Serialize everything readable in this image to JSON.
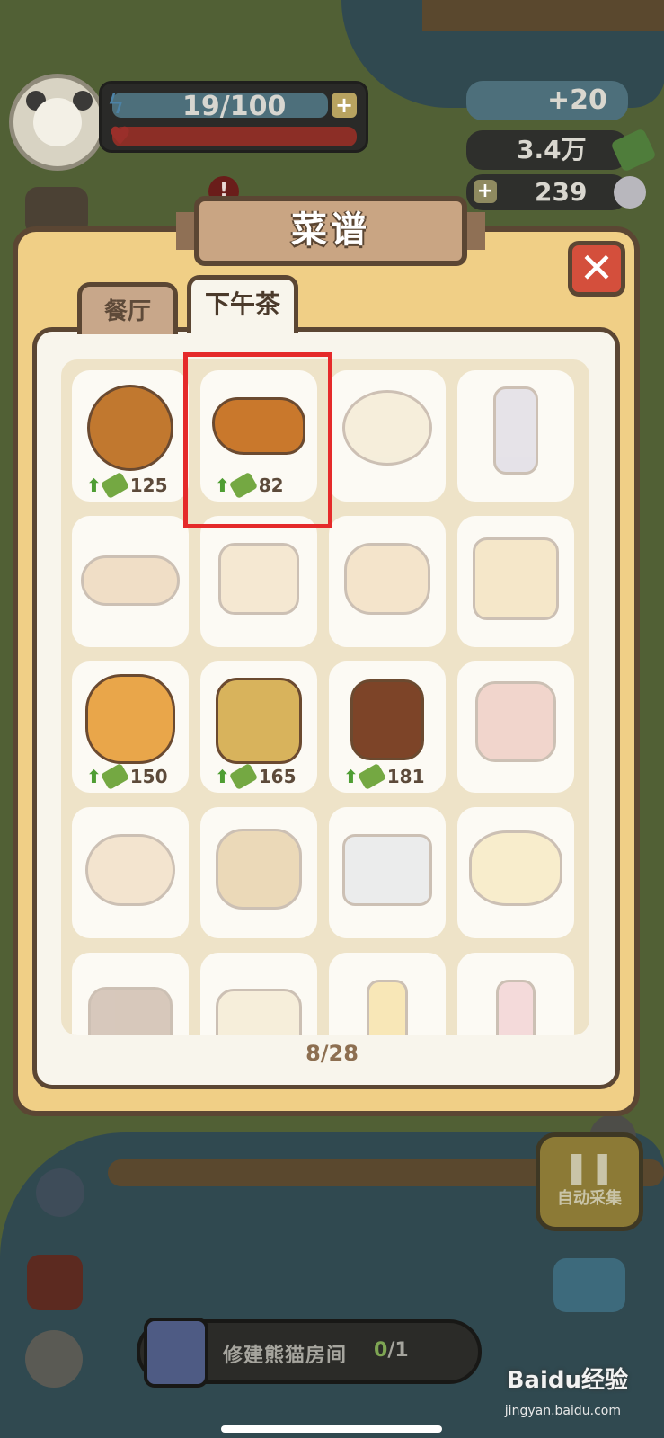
{
  "hud": {
    "energy": "19/100",
    "energy_plus": "+",
    "bamboo_rate": "+20",
    "bamboo_total": "3.4万",
    "pearl_plus": "+",
    "pearls": "239",
    "alert": "!"
  },
  "modal": {
    "title": "菜谱",
    "close": "✕",
    "tabs": [
      {
        "label": "餐厅",
        "active": false
      },
      {
        "label": "下午茶",
        "active": true
      }
    ],
    "page": "8/28"
  },
  "recipes": [
    {
      "name": "donut-icon",
      "price": "125",
      "unlocked": true
    },
    {
      "name": "croissant-icon",
      "price": "82",
      "unlocked": true,
      "highlighted": true
    },
    {
      "name": "dumpling-bun-icon",
      "unlocked": false
    },
    {
      "name": "flower-jar-icon",
      "unlocked": false
    },
    {
      "name": "baguette-trio-icon",
      "unlocked": false
    },
    {
      "name": "pancake-stack-icon",
      "unlocked": false
    },
    {
      "name": "blueberry-pudding-icon",
      "unlocked": false
    },
    {
      "name": "wrapped-cake-icon",
      "unlocked": false
    },
    {
      "name": "cookie-bag-icon",
      "price": "150",
      "unlocked": true
    },
    {
      "name": "mango-cake-icon",
      "price": "165",
      "unlocked": true
    },
    {
      "name": "cherry-chocolate-cake-icon",
      "price": "181",
      "unlocked": true
    },
    {
      "name": "cream-cake-icon",
      "unlocked": false
    },
    {
      "name": "strawberry-roll-icon",
      "unlocked": false
    },
    {
      "name": "fruit-tart-icon",
      "unlocked": false
    },
    {
      "name": "blueberry-cup-icon",
      "unlocked": false
    },
    {
      "name": "lemon-cake-icon",
      "unlocked": false
    },
    {
      "name": "chocolate-cake-icon",
      "unlocked": false
    },
    {
      "name": "berry-tart-icon",
      "unlocked": false
    },
    {
      "name": "orange-juice-icon",
      "unlocked": false
    },
    {
      "name": "strawberry-milk-icon",
      "unlocked": false
    }
  ],
  "task": {
    "label": "修建熊猫房间",
    "done": "0",
    "total": "/1"
  },
  "auto_collect": "自动采集",
  "watermark": "Baidu经验",
  "watermark_sub": "jingyan.baidu.com",
  "colors": {
    "modal_bg": "#f0cf86",
    "border": "#5b4633",
    "close_red": "#d44f3c",
    "highlight_red": "#e52a2a",
    "price_up_green": "#4f9e33"
  }
}
